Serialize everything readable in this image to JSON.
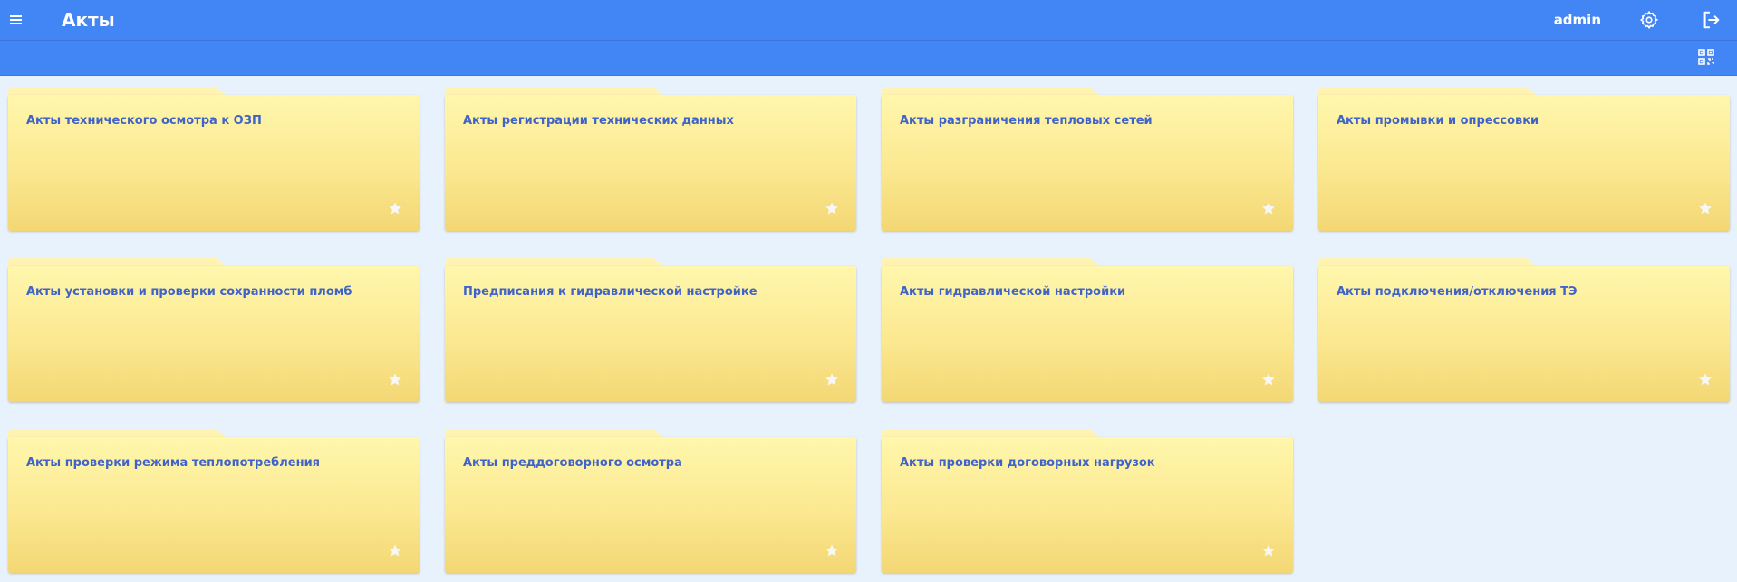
{
  "header": {
    "title": "Акты",
    "user": "admin",
    "icons": {
      "menu": "menu-icon",
      "settings": "gear-icon",
      "logout": "logout-icon",
      "qr": "qr-code-icon"
    }
  },
  "colors": {
    "header_bg": "#4285f4",
    "page_bg": "#e8f2fd",
    "folder_top": "#fff7ad",
    "folder_bottom": "#f3d774",
    "folder_title": "#3f63c9",
    "star": "#f4f4f4"
  },
  "folders": [
    {
      "title": "Акты технического осмотра к ОЗП"
    },
    {
      "title": "Акты регистрации технических данных"
    },
    {
      "title": "Акты разграничения тепловых сетей"
    },
    {
      "title": "Акты промывки и опрессовки"
    },
    {
      "title": "Акты установки и проверки сохранности пломб"
    },
    {
      "title": "Предписания к гидравлической настройке"
    },
    {
      "title": "Акты гидравлической настройки"
    },
    {
      "title": "Акты подключения/отключения ТЭ"
    },
    {
      "title": "Акты проверки режима теплопотребления"
    },
    {
      "title": "Акты преддоговорного осмотра"
    },
    {
      "title": "Акты проверки договорных нагрузок"
    }
  ]
}
